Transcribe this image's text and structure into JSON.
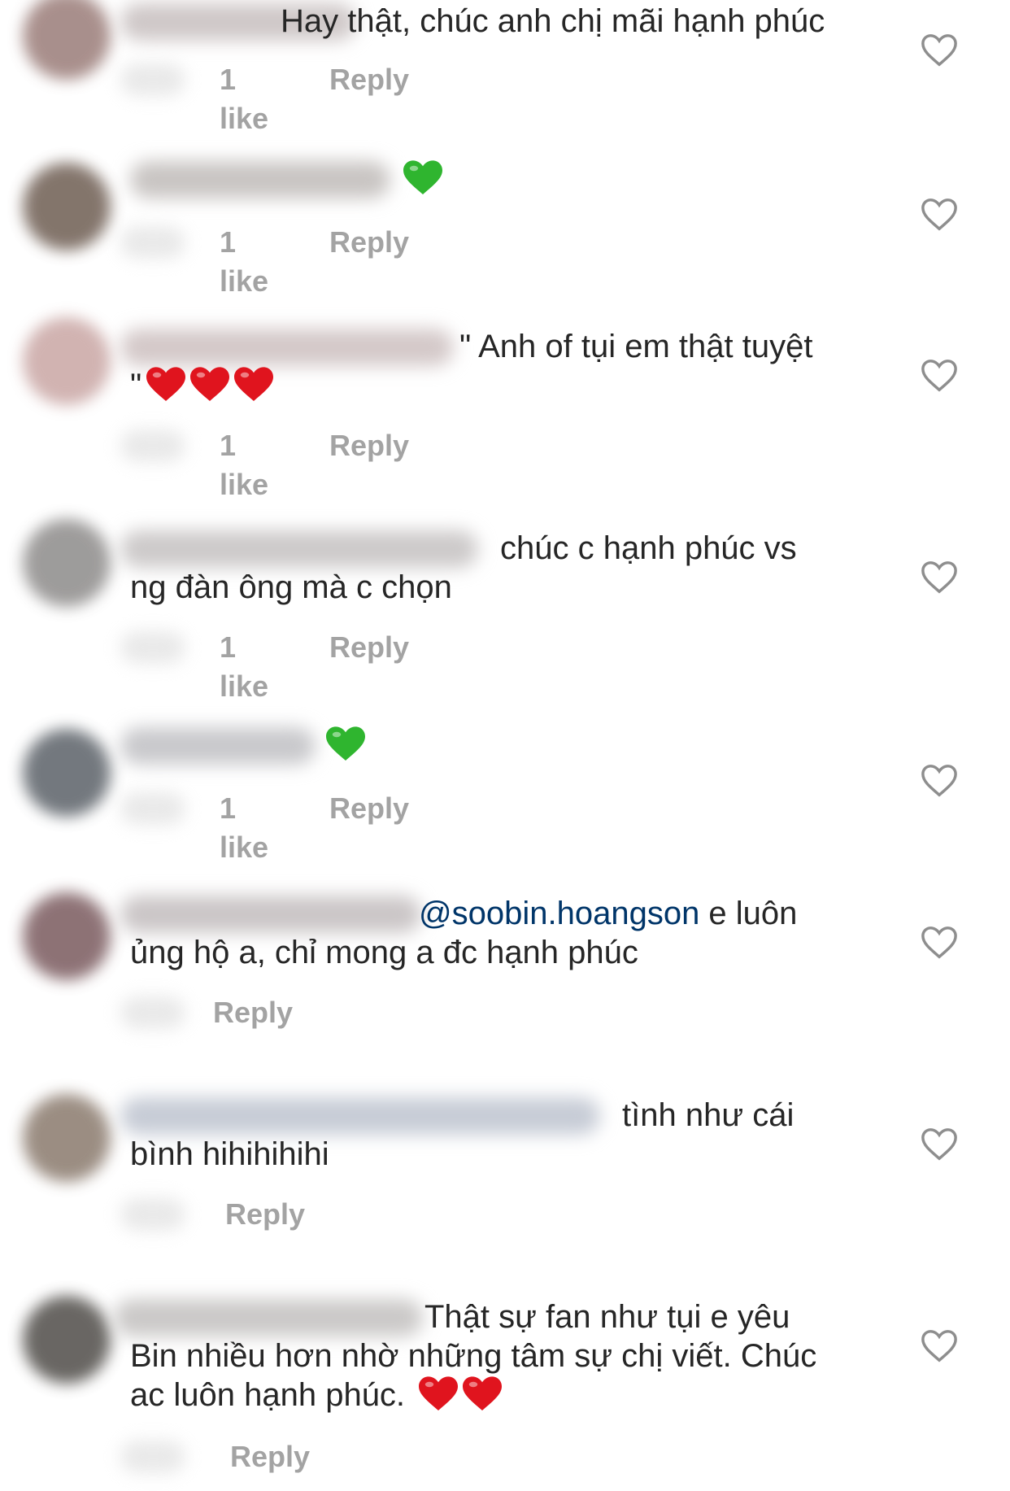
{
  "comments": [
    {
      "text_before": "",
      "mention": "",
      "text": "Hay thật, chúc anh chị mãi hạnh phúc",
      "emoji": [],
      "likes": "1 like",
      "reply": "Reply",
      "avatar_color": "#9a7c78",
      "uname_color": "#cfc8c8"
    },
    {
      "text_before": "",
      "mention": "",
      "text": "",
      "emoji": [
        "green-heart"
      ],
      "likes": "1 like",
      "reply": "Reply",
      "avatar_color": "#6e5d52",
      "uname_color": "#c9c5c3"
    },
    {
      "text_before": "",
      "mention": "",
      "text": "\" Anh of tụi em thật tuyệt\n\"",
      "emoji": [
        "red-heart",
        "red-heart",
        "red-heart"
      ],
      "likes": "1 like",
      "reply": "Reply",
      "avatar_color": "#c9a6a4",
      "uname_color": "#d4c9c9"
    },
    {
      "text_before": "",
      "mention": "",
      "text": "chúc c hạnh phúc vs\nng đàn ông mà c chọn",
      "emoji": [],
      "likes": "1 like",
      "reply": "Reply",
      "avatar_color": "#8d8b8a",
      "uname_color": "#cdcaca"
    },
    {
      "text_before": "",
      "mention": "",
      "text": "",
      "emoji": [
        "green-heart"
      ],
      "likes": "1 like",
      "reply": "Reply",
      "avatar_color": "#5b6168",
      "uname_color": "#c9c9cc"
    },
    {
      "text_before": "",
      "mention": "@soobin.hoangson",
      "text": " e luôn\nủng hộ a, chỉ mong a đc hạnh phúc",
      "emoji": [],
      "likes": "",
      "reply": "Reply",
      "avatar_color": "#7a5a5e",
      "uname_color": "#cbc6c7"
    },
    {
      "text_before": "",
      "mention": "",
      "text": "tình như cái\nbình hihihihihi",
      "emoji": [],
      "likes": "",
      "reply": "Reply",
      "avatar_color": "#8a7a6d",
      "uname_color": "#c7ccd6"
    },
    {
      "text_before": "",
      "mention": "",
      "text": "Thật sự fan như tụi e yêu\nBin nhiều hơn nhờ những tâm sự chị viết. Chúc\nac luôn hạnh phúc. ",
      "emoji": [
        "red-heart",
        "red-heart"
      ],
      "likes": "",
      "reply": "Reply",
      "avatar_color": "#4f4c48",
      "uname_color": "#cbc9c8"
    }
  ],
  "colors": {
    "text": "#262626",
    "meta": "#a3a3a3",
    "mention": "#003569",
    "heart_outline": "#8e8e8e",
    "green_heart": "#2fb52f",
    "red_heart": "#e0141e"
  },
  "icons": {
    "like": "heart-outline-icon"
  }
}
